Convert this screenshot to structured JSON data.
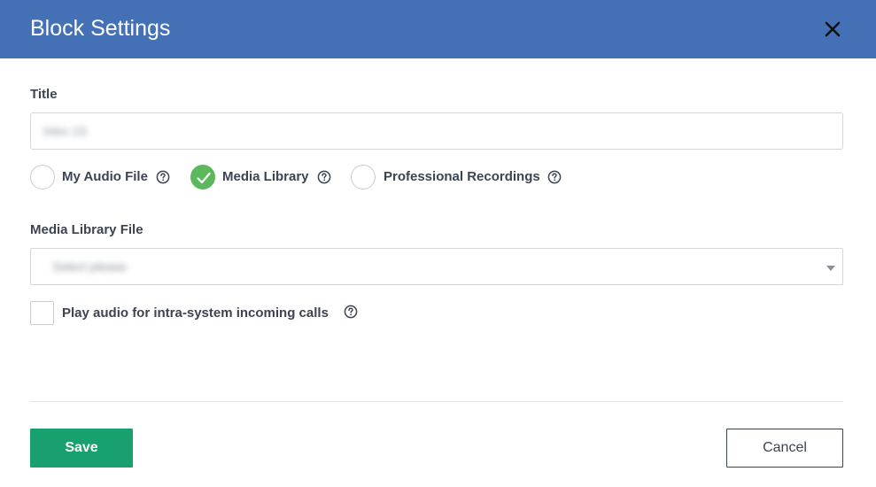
{
  "dialog": {
    "title": "Block Settings",
    "close_icon": "close-icon"
  },
  "form": {
    "title_label": "Title",
    "title_value": "Intro 1S",
    "audio_source": {
      "options": [
        {
          "label": "My Audio File",
          "selected": false,
          "help_icon": "help-circle-icon"
        },
        {
          "label": "Media Library",
          "selected": true,
          "help_icon": "help-circle-icon"
        },
        {
          "label": "Professional Recordings",
          "selected": false,
          "help_icon": "help-circle-icon"
        }
      ]
    },
    "media_file_label": "Media Library File",
    "media_file_value": "Select please",
    "play_audio_label": "Play audio for intra-system incoming calls",
    "play_audio_checked": false
  },
  "footer": {
    "save_label": "Save",
    "cancel_label": "Cancel"
  },
  "colors": {
    "header_bg": "#4471b6",
    "save_bg": "#19a06f",
    "radio_checked": "#5bb85d",
    "label_text": "#3d4451"
  }
}
